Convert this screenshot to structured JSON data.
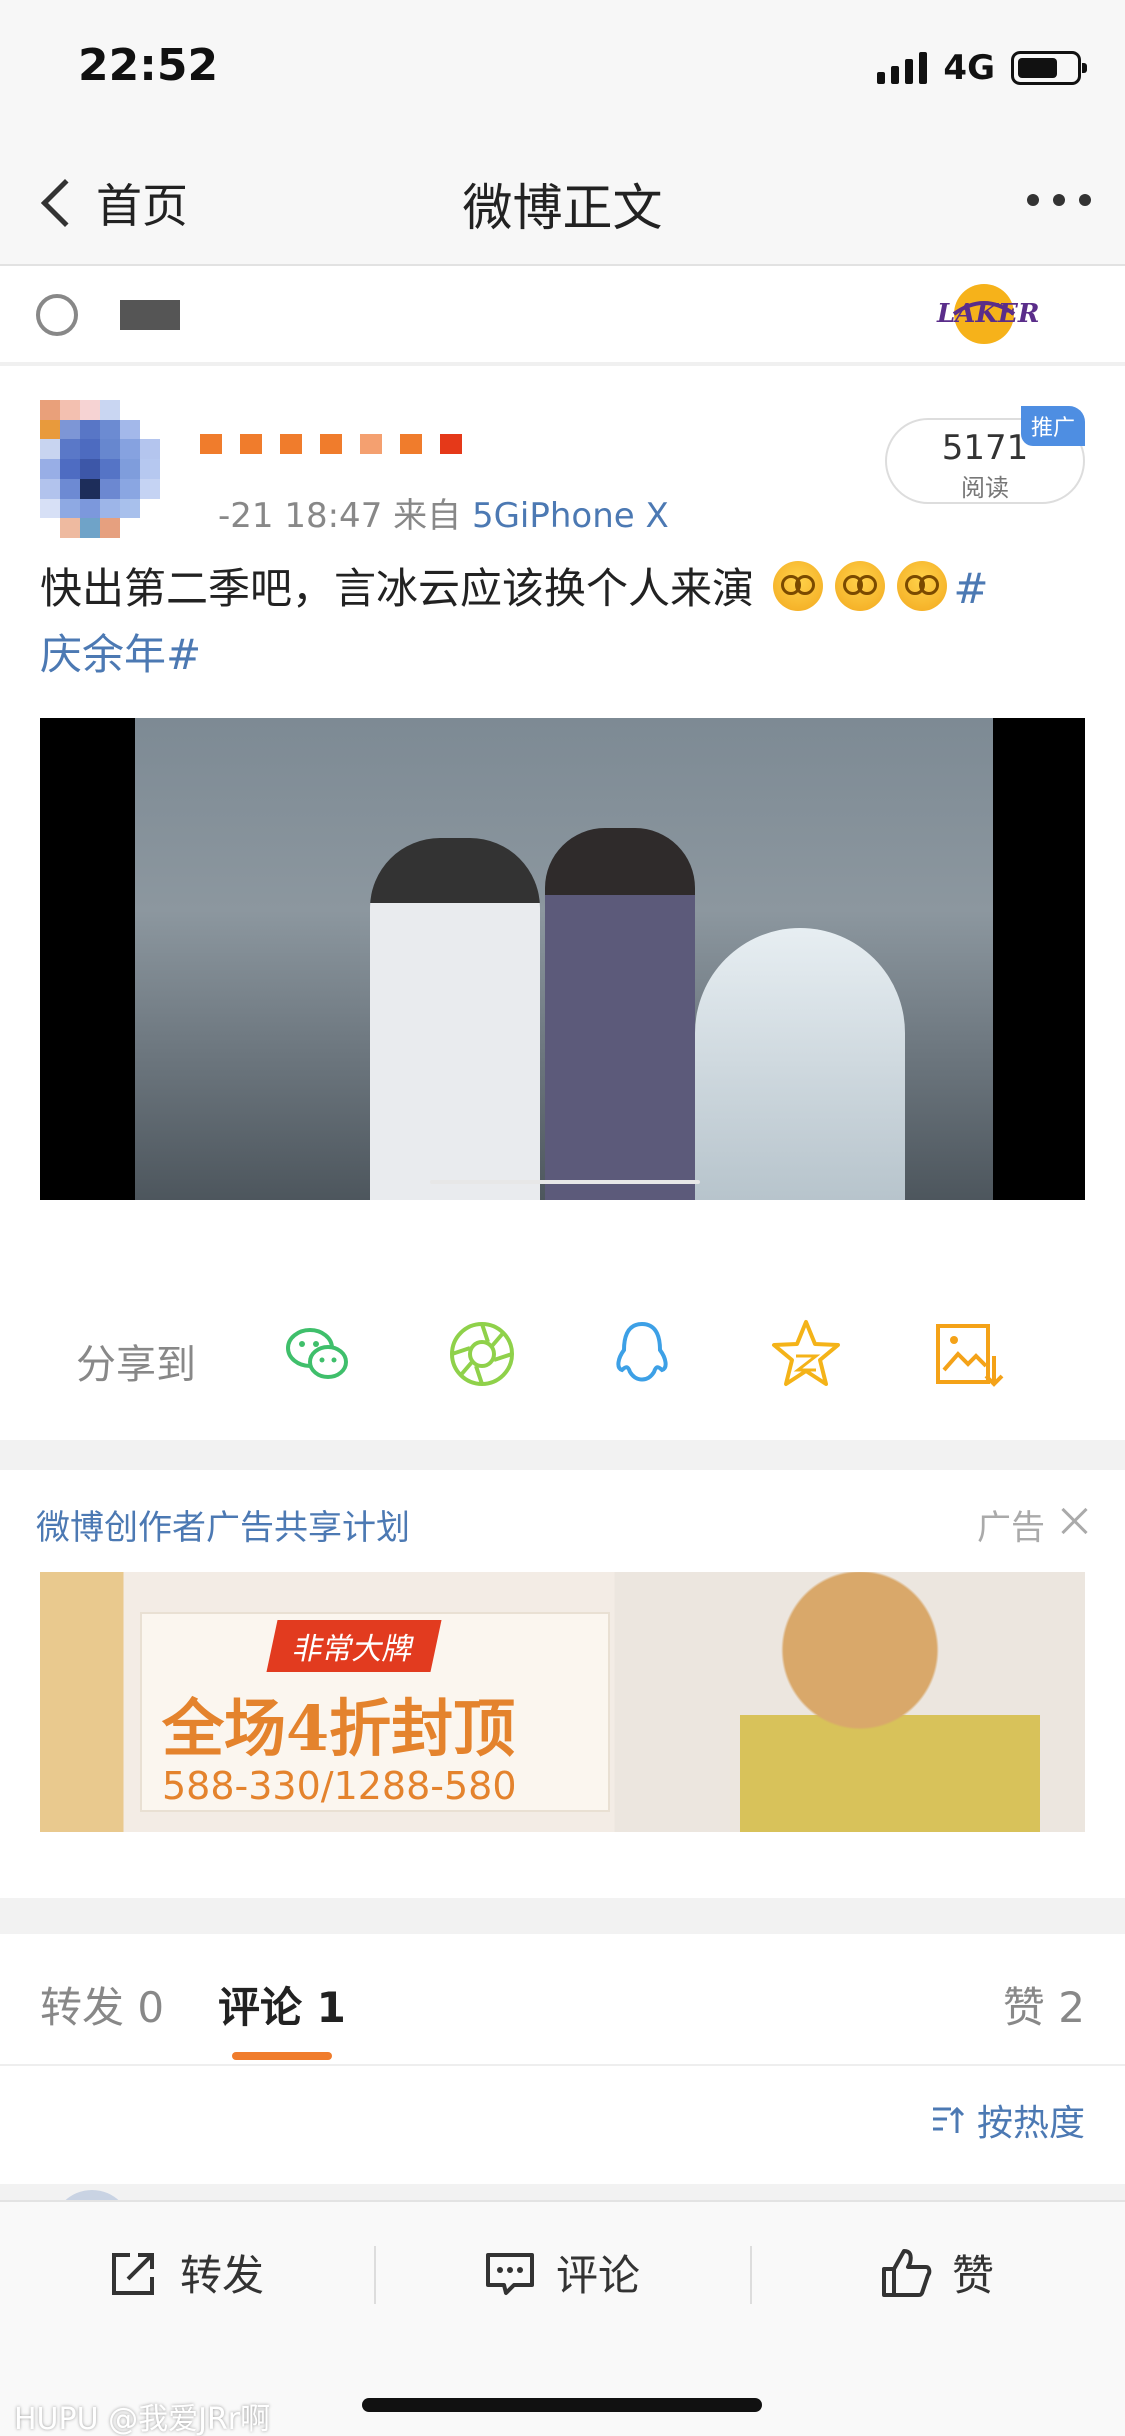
{
  "status_bar": {
    "time": "22:52",
    "network": "4G",
    "battery_level": 0.7
  },
  "nav": {
    "back_label": "首页",
    "title": "微博正文"
  },
  "post": {
    "read_count": "5171",
    "read_label": "阅读",
    "promo_badge": "推广",
    "time": "-21 18:47",
    "source_prefix": "来自",
    "source": "5GiPhone X",
    "text": "快出第二季吧，言冰云应该换个人来演",
    "hashtag_start": "#",
    "hashtag": "庆余年#",
    "emoji_name": "dizzy-face-emoji"
  },
  "share": {
    "label": "分享到",
    "targets": [
      {
        "name": "wechat-icon",
        "color": "#3fbf6b"
      },
      {
        "name": "moments-icon",
        "color": "#8fd14a"
      },
      {
        "name": "qq-icon",
        "color": "#3da0e6"
      },
      {
        "name": "favorite-star-icon",
        "color": "#f4b318"
      },
      {
        "name": "save-image-icon",
        "color": "#f4a218"
      }
    ]
  },
  "ad": {
    "plan_label": "微博创作者广告共享计划",
    "ad_label": "广告",
    "brand_tag": "非常大牌",
    "headline": "全场4折封顶",
    "price": "588-330/1288-580"
  },
  "tabs": {
    "repost": "转发 0",
    "comment": "评论 1",
    "like": "赞 2",
    "sort": "按热度"
  },
  "bottom_bar": {
    "repost": "转发",
    "comment": "评论",
    "like": "赞"
  },
  "watermark": "HUPU @我爱JRr啊"
}
